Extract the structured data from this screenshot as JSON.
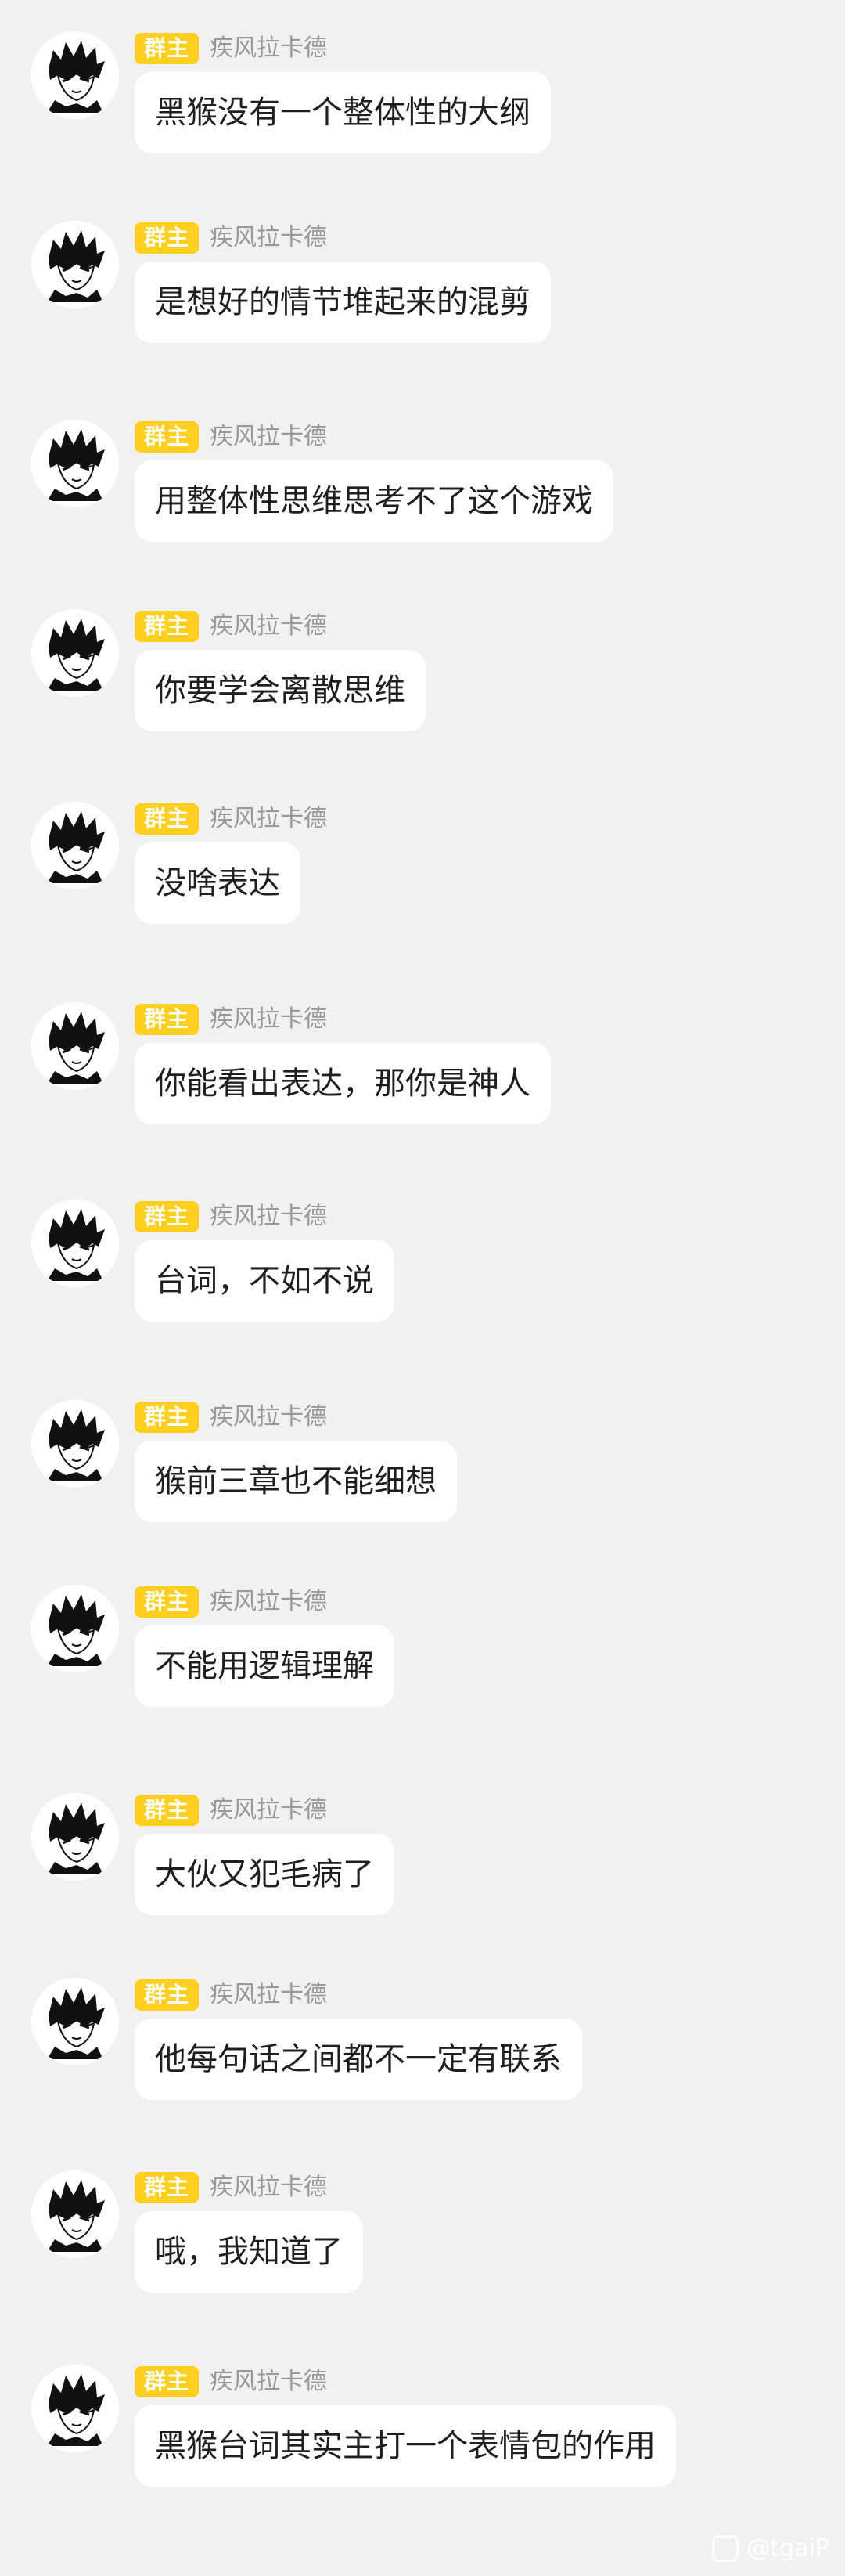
{
  "group": {
    "role_badge": "群主",
    "sender_name": "疾风拉卡德",
    "avatar": "manga-character-avatar"
  },
  "messages": [
    {
      "text": "黑猴没有一个整体性的大纲"
    },
    {
      "text": "是想好的情节堆起来的混剪"
    },
    {
      "text": "用整体性思维思考不了这个游戏"
    },
    {
      "text": "你要学会离散思维"
    },
    {
      "text": "没啥表达"
    },
    {
      "text": "你能看出表达，那你是神人"
    },
    {
      "text": "台词，不如不说"
    },
    {
      "text": "猴前三章也不能细想"
    },
    {
      "text": "不能用逻辑理解"
    },
    {
      "text": "大伙又犯毛病了"
    },
    {
      "text": "他每句话之间都不一定有联系"
    },
    {
      "text": "哦，我知道了"
    },
    {
      "text": "黑猴台词其实主打一个表情包的作用"
    }
  ],
  "watermark": {
    "text": "@tgaiP"
  },
  "colors": {
    "background": "#f1f1f1",
    "bubble": "#ffffff",
    "badge": "#ffcf1f",
    "sender_text": "#999999",
    "message_text": "#1f1f1f"
  }
}
